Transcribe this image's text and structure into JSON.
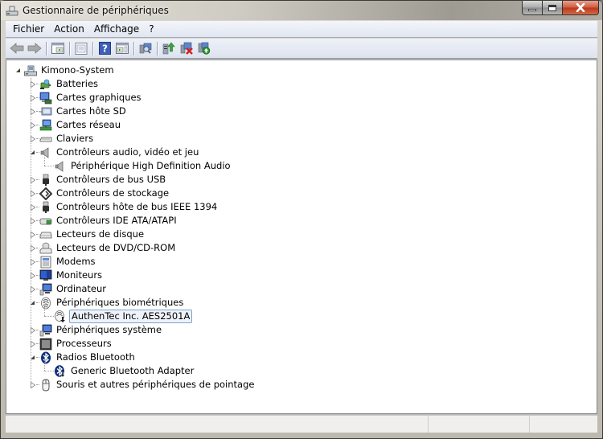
{
  "window": {
    "title": "Gestionnaire de périphériques",
    "controls": {
      "minimize": "minimize",
      "maximize": "maximize",
      "close": "close"
    }
  },
  "menubar": {
    "items": [
      {
        "label": "Fichier"
      },
      {
        "label": "Action"
      },
      {
        "label": "Affichage"
      },
      {
        "label": "?"
      }
    ]
  },
  "toolbar": {
    "buttons": [
      {
        "name": "back",
        "icon": "arrow-left-icon"
      },
      {
        "name": "forward",
        "icon": "arrow-right-icon"
      },
      {
        "name": "show-hide-console-tree",
        "icon": "console-tree-icon"
      },
      {
        "name": "properties",
        "icon": "properties-icon"
      },
      {
        "name": "help",
        "icon": "help-icon"
      },
      {
        "name": "show-hide-action-pane",
        "icon": "action-pane-icon"
      },
      {
        "name": "scan-hardware-changes",
        "icon": "scan-hardware-icon"
      },
      {
        "name": "update-driver",
        "icon": "update-driver-icon"
      },
      {
        "name": "uninstall",
        "icon": "uninstall-icon"
      },
      {
        "name": "enable",
        "icon": "enable-device-icon"
      }
    ]
  },
  "tree": {
    "root": {
      "label": "Kimono-System",
      "expanded": true,
      "icon": "computer-icon"
    },
    "categories": [
      {
        "label": "Batteries",
        "icon": "battery-icon",
        "expanded": false
      },
      {
        "label": "Cartes graphiques",
        "icon": "display-adapter-icon",
        "expanded": false
      },
      {
        "label": "Cartes hôte SD",
        "icon": "sd-host-icon",
        "expanded": false
      },
      {
        "label": "Cartes réseau",
        "icon": "network-adapter-icon",
        "expanded": false
      },
      {
        "label": "Claviers",
        "icon": "keyboard-icon",
        "expanded": false
      },
      {
        "label": "Contrôleurs audio, vidéo et jeu",
        "icon": "speaker-icon",
        "expanded": true,
        "children": [
          {
            "label": "Périphérique High Definition Audio",
            "icon": "speaker-icon"
          }
        ]
      },
      {
        "label": "Contrôleurs de bus USB",
        "icon": "usb-icon",
        "expanded": false
      },
      {
        "label": "Contrôleurs de stockage",
        "icon": "storage-controller-icon",
        "expanded": false
      },
      {
        "label": "Contrôleurs hôte de bus IEEE 1394",
        "icon": "ieee1394-icon",
        "expanded": false
      },
      {
        "label": "Contrôleurs IDE ATA/ATAPI",
        "icon": "ide-controller-icon",
        "expanded": false
      },
      {
        "label": "Lecteurs de disque",
        "icon": "disk-drive-icon",
        "expanded": false
      },
      {
        "label": "Lecteurs de DVD/CD-ROM",
        "icon": "dvd-drive-icon",
        "expanded": false
      },
      {
        "label": "Modems",
        "icon": "modem-icon",
        "expanded": false
      },
      {
        "label": "Moniteurs",
        "icon": "monitor-icon",
        "expanded": false
      },
      {
        "label": "Ordinateur",
        "icon": "computer-icon",
        "expanded": false
      },
      {
        "label": "Périphériques biométriques",
        "icon": "fingerprint-icon",
        "expanded": true,
        "children": [
          {
            "label": "AuthenTec Inc. AES2501A",
            "icon": "fingerprint-device-icon",
            "selected": true
          }
        ]
      },
      {
        "label": "Périphériques système",
        "icon": "system-devices-icon",
        "expanded": false
      },
      {
        "label": "Processeurs",
        "icon": "processor-icon",
        "expanded": false
      },
      {
        "label": "Radios Bluetooth",
        "icon": "bluetooth-icon",
        "expanded": true,
        "children": [
          {
            "label": "Generic Bluetooth Adapter",
            "icon": "bluetooth-device-icon"
          }
        ]
      },
      {
        "label": "Souris et autres périphériques de pointage",
        "icon": "mouse-icon",
        "expanded": false
      }
    ]
  },
  "statusbar": {
    "panes": [
      "",
      "",
      ""
    ]
  },
  "colors": {
    "selection_border": "#7da2ce",
    "selection_bg": "#eef3fa",
    "close_button": "#c8452a"
  }
}
